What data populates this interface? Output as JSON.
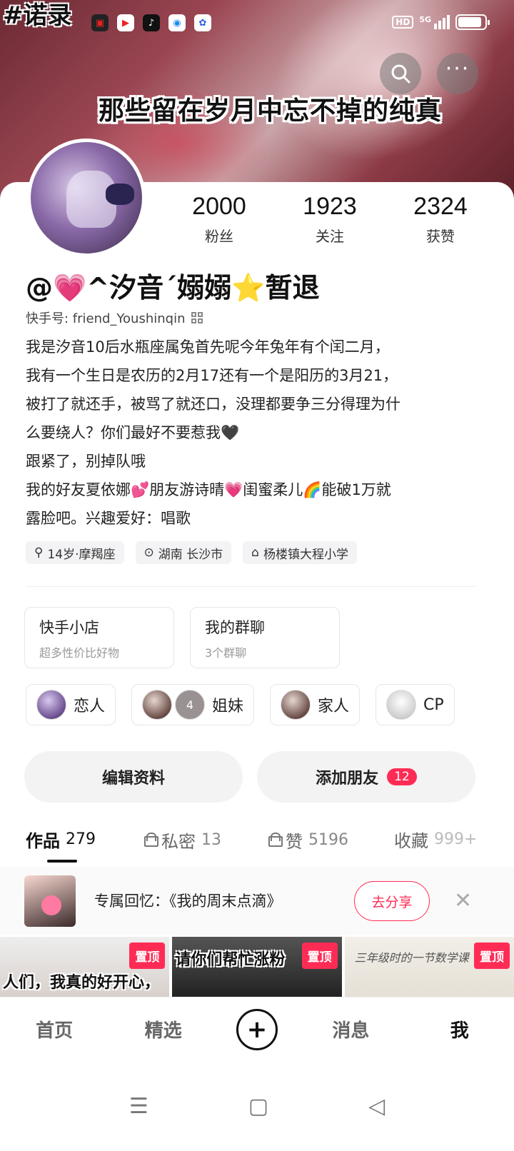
{
  "cover": {
    "hashtag": "#诺录",
    "caption": "那些留在岁月中忘不掉的纯真"
  },
  "status_bar": {
    "network": "HD",
    "signal": "5G",
    "battery_level": 0.9
  },
  "profile": {
    "stats": [
      {
        "num": "2000",
        "label": "粉丝"
      },
      {
        "num": "1923",
        "label": "关注"
      },
      {
        "num": "2324",
        "label": "获赞"
      }
    ],
    "nickname": "@💗^汐音ˊ嫋嫋⭐暂退",
    "kuaishou_id": "快手号: friend_Youshinqin",
    "bio_lines": [
      "我是汐音10后水瓶座属兔首先呢今年兔年有个闰二月，",
      "我有一个生日是农历的2月17还有一个是阳历的3月21，",
      "被打了就还手，被骂了就还口，没理都要争三分得理为什",
      "么要绕人？你们最好不要惹我🖤",
      "跟紧了，别掉队哦",
      "我的好友夏依娜💕朋友游诗晴💗闺蜜柔儿🌈能破1万就",
      "露脸吧。兴趣爱好：唱歌"
    ],
    "tags": [
      "14岁·摩羯座",
      "湖南 长沙市",
      "杨楼镇大程小学"
    ]
  },
  "features": [
    {
      "title": "快手小店",
      "sub": "超多性价比好物"
    },
    {
      "title": "我的群聊",
      "sub": "3个群聊"
    }
  ],
  "relations": [
    {
      "label": "恋人"
    },
    {
      "label": "姐妹",
      "badge": "4"
    },
    {
      "label": "家人"
    },
    {
      "label": "CP"
    }
  ],
  "actions": {
    "edit": "编辑资料",
    "add_friend": "添加朋友",
    "add_friend_badge": "12"
  },
  "tabs": [
    {
      "label": "作品",
      "count": "279"
    },
    {
      "label": "私密",
      "count": "13"
    },
    {
      "label": "赞",
      "count": "5196"
    },
    {
      "label": "收藏",
      "count": "999+"
    }
  ],
  "memory": {
    "text": "专属回忆：《我的周末点滴》",
    "share": "去分享"
  },
  "grid": [
    {
      "pin": "置顶",
      "caption": "人们，我真的好开心，"
    },
    {
      "pin": "置顶",
      "caption": "请你们帮忙涨粉"
    },
    {
      "pin": "置顶",
      "caption": "三年级时的一节数学课"
    }
  ],
  "bottom_nav": [
    "首页",
    "精选",
    "消息",
    "我"
  ]
}
